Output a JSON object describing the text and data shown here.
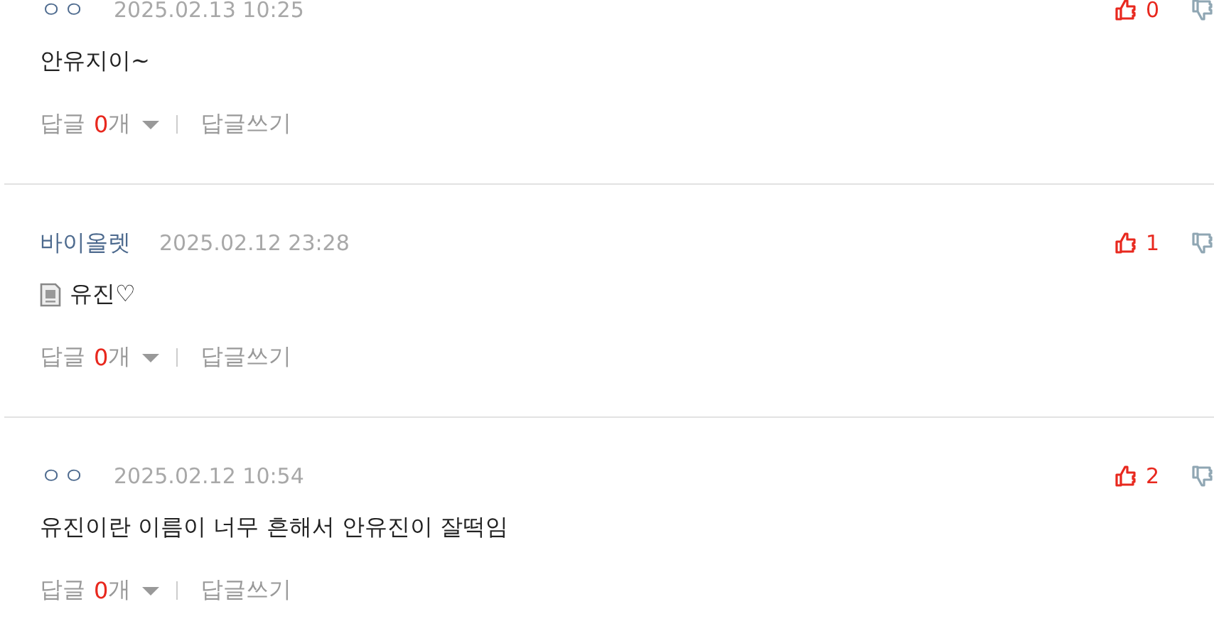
{
  "comments": [
    {
      "author": "ㅇㅇ",
      "date": "2025.02.13 10:25",
      "has_attachment": false,
      "text": "안유지이~",
      "likes": "0",
      "reply_label": "답글",
      "reply_count": "0",
      "reply_unit": "개",
      "write_reply": "답글쓰기"
    },
    {
      "author": "바이올렛",
      "date": "2025.02.12 23:28",
      "has_attachment": true,
      "text": "유진♡",
      "likes": "1",
      "reply_label": "답글",
      "reply_count": "0",
      "reply_unit": "개",
      "write_reply": "답글쓰기"
    },
    {
      "author": "ㅇㅇ",
      "date": "2025.02.12 10:54",
      "has_attachment": false,
      "text": "유진이란 이름이 너무 흔해서 안유진이 잘떡임",
      "likes": "2",
      "reply_label": "답글",
      "reply_count": "0",
      "reply_unit": "개",
      "write_reply": "답글쓰기"
    }
  ]
}
